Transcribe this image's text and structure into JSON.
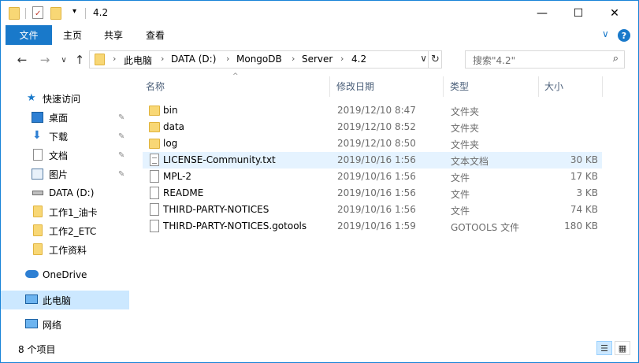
{
  "window": {
    "title": "4.2",
    "minimize": "—",
    "maximize": "☐",
    "close": "✕"
  },
  "ribbon": {
    "file_tab": "文件",
    "tabs": [
      "主页",
      "共享",
      "查看"
    ],
    "collapse": "∨",
    "help": "?"
  },
  "nav": {
    "back": "←",
    "forward": "→",
    "recent": "∨",
    "up": "↑"
  },
  "address": {
    "crumbs": [
      "此电脑",
      "DATA (D:)",
      "MongoDB",
      "Server",
      "4.2"
    ],
    "chevron": "›",
    "dropdown": "∨",
    "refresh": "↻"
  },
  "search": {
    "placeholder": "搜索\"4.2\"",
    "icon": "⌕"
  },
  "sidebar": {
    "quick_access": "快速访问",
    "items": [
      {
        "label": "桌面",
        "pinned": true,
        "icon": "desktop-icon"
      },
      {
        "label": "下载",
        "pinned": true,
        "icon": "download-icon"
      },
      {
        "label": "文档",
        "pinned": true,
        "icon": "document-icon"
      },
      {
        "label": "图片",
        "pinned": true,
        "icon": "picture-icon"
      },
      {
        "label": "DATA (D:)",
        "pinned": false,
        "icon": "drive-icon"
      },
      {
        "label": "工作1_油卡",
        "pinned": false,
        "icon": "folder-icon"
      },
      {
        "label": "工作2_ETC",
        "pinned": false,
        "icon": "folder-icon"
      },
      {
        "label": "工作资料",
        "pinned": false,
        "icon": "folder-icon"
      }
    ],
    "onedrive": "OneDrive",
    "this_pc": "此电脑",
    "network": "网络",
    "pin_glyph": "📌"
  },
  "columns": {
    "name": "名称",
    "date": "修改日期",
    "type": "类型",
    "size": "大小",
    "sort_glyph": "^"
  },
  "files": [
    {
      "name": "bin",
      "date": "2019/12/10 8:47",
      "type": "文件夹",
      "size": "",
      "kind": "folder"
    },
    {
      "name": "data",
      "date": "2019/12/10 8:52",
      "type": "文件夹",
      "size": "",
      "kind": "folder"
    },
    {
      "name": "log",
      "date": "2019/12/10 8:50",
      "type": "文件夹",
      "size": "",
      "kind": "folder"
    },
    {
      "name": "LICENSE-Community.txt",
      "date": "2019/10/16 1:56",
      "type": "文本文档",
      "size": "30 KB",
      "kind": "txt"
    },
    {
      "name": "MPL-2",
      "date": "2019/10/16 1:56",
      "type": "文件",
      "size": "17 KB",
      "kind": "file"
    },
    {
      "name": "README",
      "date": "2019/10/16 1:56",
      "type": "文件",
      "size": "3 KB",
      "kind": "file"
    },
    {
      "name": "THIRD-PARTY-NOTICES",
      "date": "2019/10/16 1:56",
      "type": "文件",
      "size": "74 KB",
      "kind": "file"
    },
    {
      "name": "THIRD-PARTY-NOTICES.gotools",
      "date": "2019/10/16 1:59",
      "type": "GOTOOLS 文件",
      "size": "180 KB",
      "kind": "file"
    }
  ],
  "status": {
    "count": "8 个项目"
  },
  "colors": {
    "accent": "#1979ca",
    "selection": "#cce8ff",
    "hover_row": "#e5f3ff",
    "folder": "#f8d775"
  }
}
